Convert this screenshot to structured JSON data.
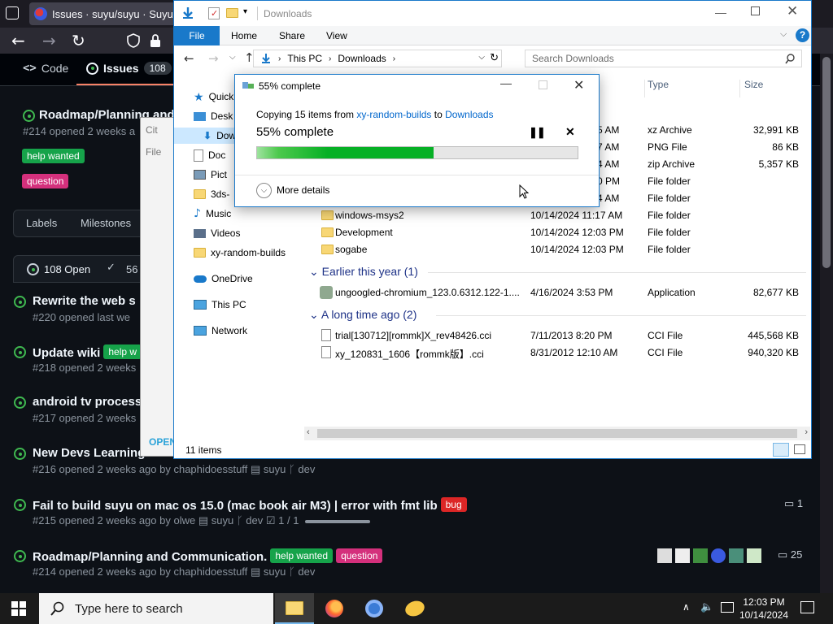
{
  "browser": {
    "tab_title": "Issues · suyu/suyu · Suyu Git",
    "repo_nav": {
      "code": "Code",
      "issues": "Issues",
      "issues_count": "108"
    },
    "labels_button": "Labels",
    "milestones_button": "Milestones",
    "open_count": "108 Open",
    "closed_count": "56",
    "issues": [
      {
        "title": "Roadmap/Planning and Co",
        "meta": "#214 opened 2 weeks a",
        "labels": [
          "help wanted",
          "question"
        ]
      },
      {
        "title": "Rewrite the web s",
        "meta": "#220 opened last we",
        "labels": []
      },
      {
        "title": "Update wiki",
        "meta": "#218 opened 2 weeks",
        "labels": [
          "help w"
        ]
      },
      {
        "title": "android tv process",
        "meta": "#217 opened 2 weeks",
        "labels": []
      },
      {
        "title": "New Devs Learning the",
        "meta": "#216 opened 2 weeks ago by chaphidoesstuff",
        "repo": "suyu",
        "branch": "dev",
        "labels": []
      },
      {
        "title": "Fail to build suyu on mac os 15.0 (mac book air M3) | error with fmt lib",
        "meta": "#215 opened 2 weeks ago by olwe",
        "repo": "suyu",
        "branch": "dev",
        "tasks": "1 / 1",
        "labels": [
          "bug"
        ],
        "comments": "1"
      },
      {
        "title": "Roadmap/Planning and Communication.",
        "meta": "#214 opened 2 weeks ago by chaphidoesstuff",
        "repo": "suyu",
        "branch": "dev",
        "labels": [
          "help wanted",
          "question"
        ],
        "comments": "25"
      }
    ],
    "open_tab_partial": "OPEN"
  },
  "background_window": {
    "title_partial": "Cit",
    "menu_partial": "File"
  },
  "explorer": {
    "title": "Downloads",
    "ribbon_tabs": [
      "File",
      "Home",
      "Share",
      "View"
    ],
    "breadcrumb": [
      "This PC",
      "Downloads"
    ],
    "search_placeholder": "Search Downloads",
    "columns": {
      "type": "Type",
      "size": "Size"
    },
    "nav": [
      {
        "label": "Quick",
        "icon": "star-icon"
      },
      {
        "label": "Desk",
        "icon": "desktop-icon"
      },
      {
        "label": "Dow",
        "icon": "download-icon"
      },
      {
        "label": "Doc",
        "icon": "document-icon"
      },
      {
        "label": "Pict",
        "icon": "pictures-icon"
      },
      {
        "label": "3ds-",
        "icon": "folder-icon"
      },
      {
        "label": "Music",
        "icon": "music-icon"
      },
      {
        "label": "Videos",
        "icon": "videos-icon"
      },
      {
        "label": "xy-random-builds",
        "icon": "folder-icon"
      },
      {
        "label": "OneDrive",
        "icon": "cloud-icon"
      },
      {
        "label": "This PC",
        "icon": "computer-icon"
      },
      {
        "label": "Network",
        "icon": "network-icon"
      }
    ],
    "partial_rows": [
      {
        "date_tail": "5 AM",
        "type": "xz Archive",
        "size": "32,991 KB"
      },
      {
        "date_tail": "7 AM",
        "type": "PNG File",
        "size": "86 KB"
      },
      {
        "date_tail": "4 AM",
        "type": "zip Archive",
        "size": "5,357 KB"
      },
      {
        "date_tail": "0 PM",
        "type": "File folder",
        "size": ""
      },
      {
        "date_tail": "4 AM",
        "type": "File folder",
        "size": ""
      }
    ],
    "rows": [
      {
        "name": "windows-msys2",
        "date": "10/14/2024 11:17 AM",
        "type": "File folder",
        "size": ""
      },
      {
        "name": "Development",
        "date": "10/14/2024 12:03 PM",
        "type": "File folder",
        "size": ""
      },
      {
        "name": "sogabe",
        "date": "10/14/2024 12:03 PM",
        "type": "File folder",
        "size": ""
      }
    ],
    "group_earlier": "Earlier this year (1)",
    "earlier_rows": [
      {
        "name": "ungoogled-chromium_123.0.6312.122-1....",
        "date": "4/16/2024 3:53 PM",
        "type": "Application",
        "size": "82,677 KB"
      }
    ],
    "group_long_ago": "A long time ago (2)",
    "long_ago_rows": [
      {
        "name": "trial[130712][rommk]X_rev48426.cci",
        "date": "7/11/2013 8:20 PM",
        "type": "CCI File",
        "size": "445,568 KB"
      },
      {
        "name": "xy_120831_1606【rommk版】.cci",
        "date": "8/31/2012 12:10 AM",
        "type": "CCI File",
        "size": "940,320 KB"
      }
    ],
    "status": "11 items"
  },
  "dialog": {
    "title": "55% complete",
    "copy_prefix": "Copying 15 items from",
    "source": "xy-random-builds",
    "to_word": "to",
    "destination": "Downloads",
    "status": "55% complete",
    "progress": 0.55,
    "more_details": "More details"
  },
  "taskbar": {
    "search_placeholder": "Type here to search",
    "time": "12:03 PM",
    "date": "10/14/2024"
  },
  "colors": {
    "accent": "#1979ca",
    "progress": "#06b025",
    "gh_green": "#3fb950",
    "help_wanted": "#16a34a",
    "question": "#d4307c",
    "bug": "#dc2626"
  }
}
